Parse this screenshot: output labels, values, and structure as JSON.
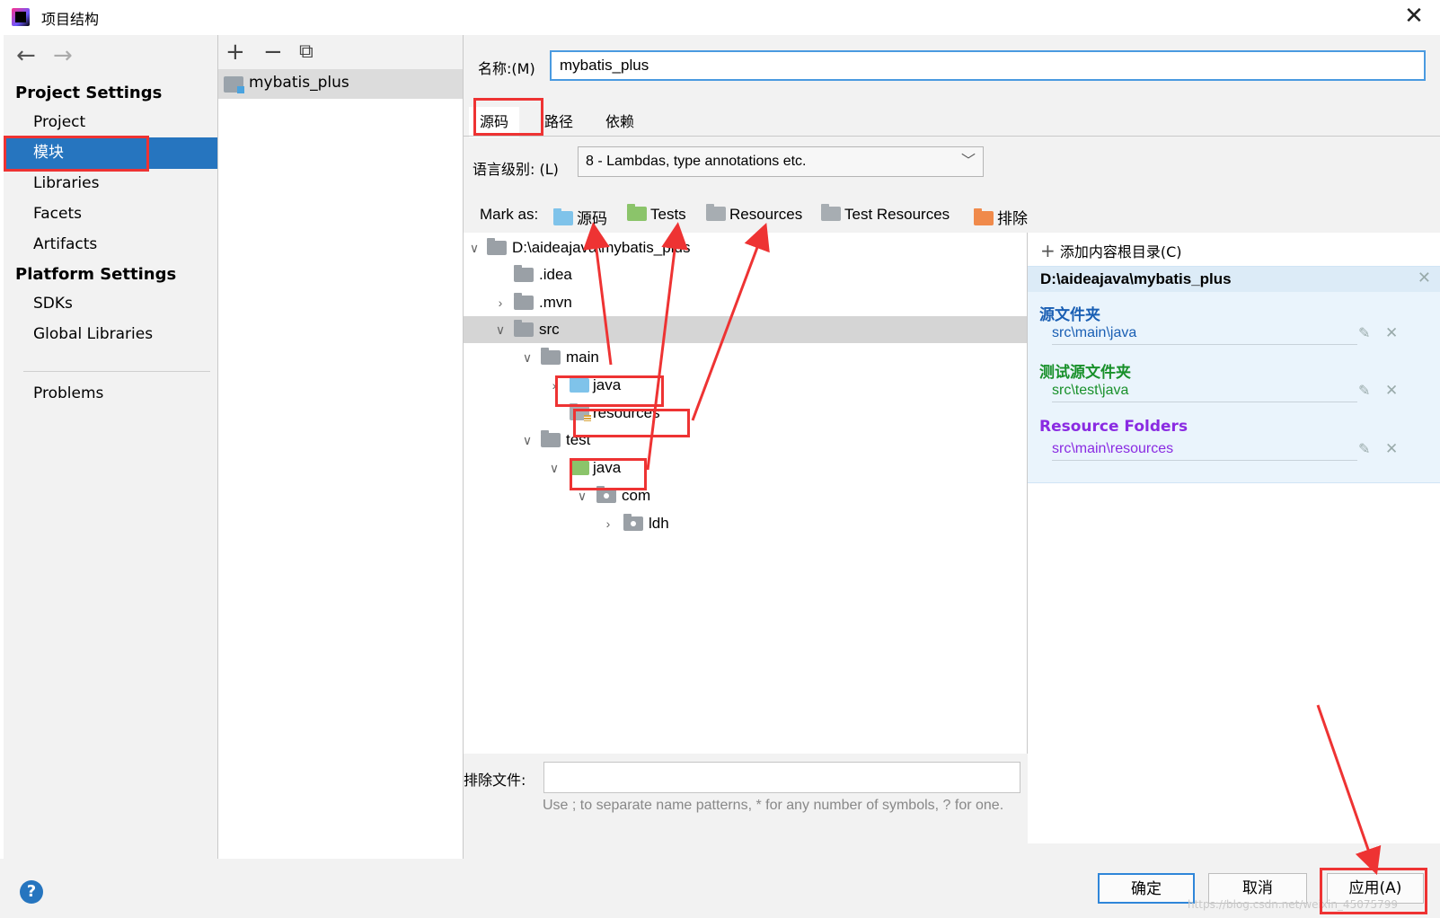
{
  "window": {
    "title": "项目结构",
    "close_symbol": "✕"
  },
  "sidebar": {
    "back_icon": "←",
    "forward_icon": "→",
    "project_settings_title": "Project Settings",
    "items": [
      {
        "label": "Project"
      },
      {
        "label": "模块"
      },
      {
        "label": "Libraries"
      },
      {
        "label": "Facets"
      },
      {
        "label": "Artifacts"
      }
    ],
    "platform_settings_title": "Platform Settings",
    "platform_items": [
      {
        "label": "SDKs"
      },
      {
        "label": "Global Libraries"
      }
    ],
    "problems_label": "Problems",
    "selected_item": "模块",
    "selected_color": "#2675bf"
  },
  "modules": {
    "toolbar": {
      "add": "+",
      "remove": "−",
      "copy": "⧉"
    },
    "list": [
      {
        "label": "mybatis_plus"
      }
    ]
  },
  "main": {
    "name_label": "名称:(M)",
    "name_value": "mybatis_plus",
    "tabs": [
      {
        "label": "源码"
      },
      {
        "label": "路径"
      },
      {
        "label": "依赖"
      }
    ],
    "active_tab": "源码",
    "language_level_label": "语言级别: (L)",
    "language_level_value": "8 - Lambdas, type annotations etc.",
    "mark_as_label": "Mark as:",
    "mark_as": [
      {
        "label": "源码",
        "color": "#7fc3ea"
      },
      {
        "label": "Tests",
        "color": "#8bc46a"
      },
      {
        "label": "Resources",
        "color": "#a7adb2"
      },
      {
        "label": "Test Resources",
        "color": "#a7adb2"
      },
      {
        "label": "排除",
        "color": "#f08a4b"
      }
    ],
    "tree": [
      {
        "label": "D:\\aideajava\\mybatis_plus"
      },
      {
        "label": ".idea"
      },
      {
        "label": ".mvn"
      },
      {
        "label": "src"
      },
      {
        "label": "main"
      },
      {
        "label": "java"
      },
      {
        "label": "resources"
      },
      {
        "label": "test"
      },
      {
        "label": "java"
      },
      {
        "label": "com"
      },
      {
        "label": "ldh"
      }
    ],
    "content_roots": {
      "add_label": "添加内容根目录(C)",
      "root_path": "D:\\aideajava\\mybatis_plus",
      "categories": [
        {
          "title": "源文件夹",
          "path": "src\\main\\java",
          "color": "#1a5fb4"
        },
        {
          "title": "测试源文件夹",
          "path": "src\\test\\java",
          "color": "#18902a"
        },
        {
          "title": "Resource Folders",
          "path": "src\\main\\resources",
          "color": "#8a2be2"
        }
      ]
    },
    "exclude_label": "排除文件:",
    "exclude_value": "",
    "exclude_hint": "Use ; to separate name patterns, * for any number of symbols, ? for one."
  },
  "bottom": {
    "help": "?",
    "ok_label": "确定",
    "cancel_label": "取消",
    "apply_label": "应用(A)",
    "watermark": "https://blog.csdn.net/weixin_45075799"
  },
  "annotations_color": "#ee3333"
}
